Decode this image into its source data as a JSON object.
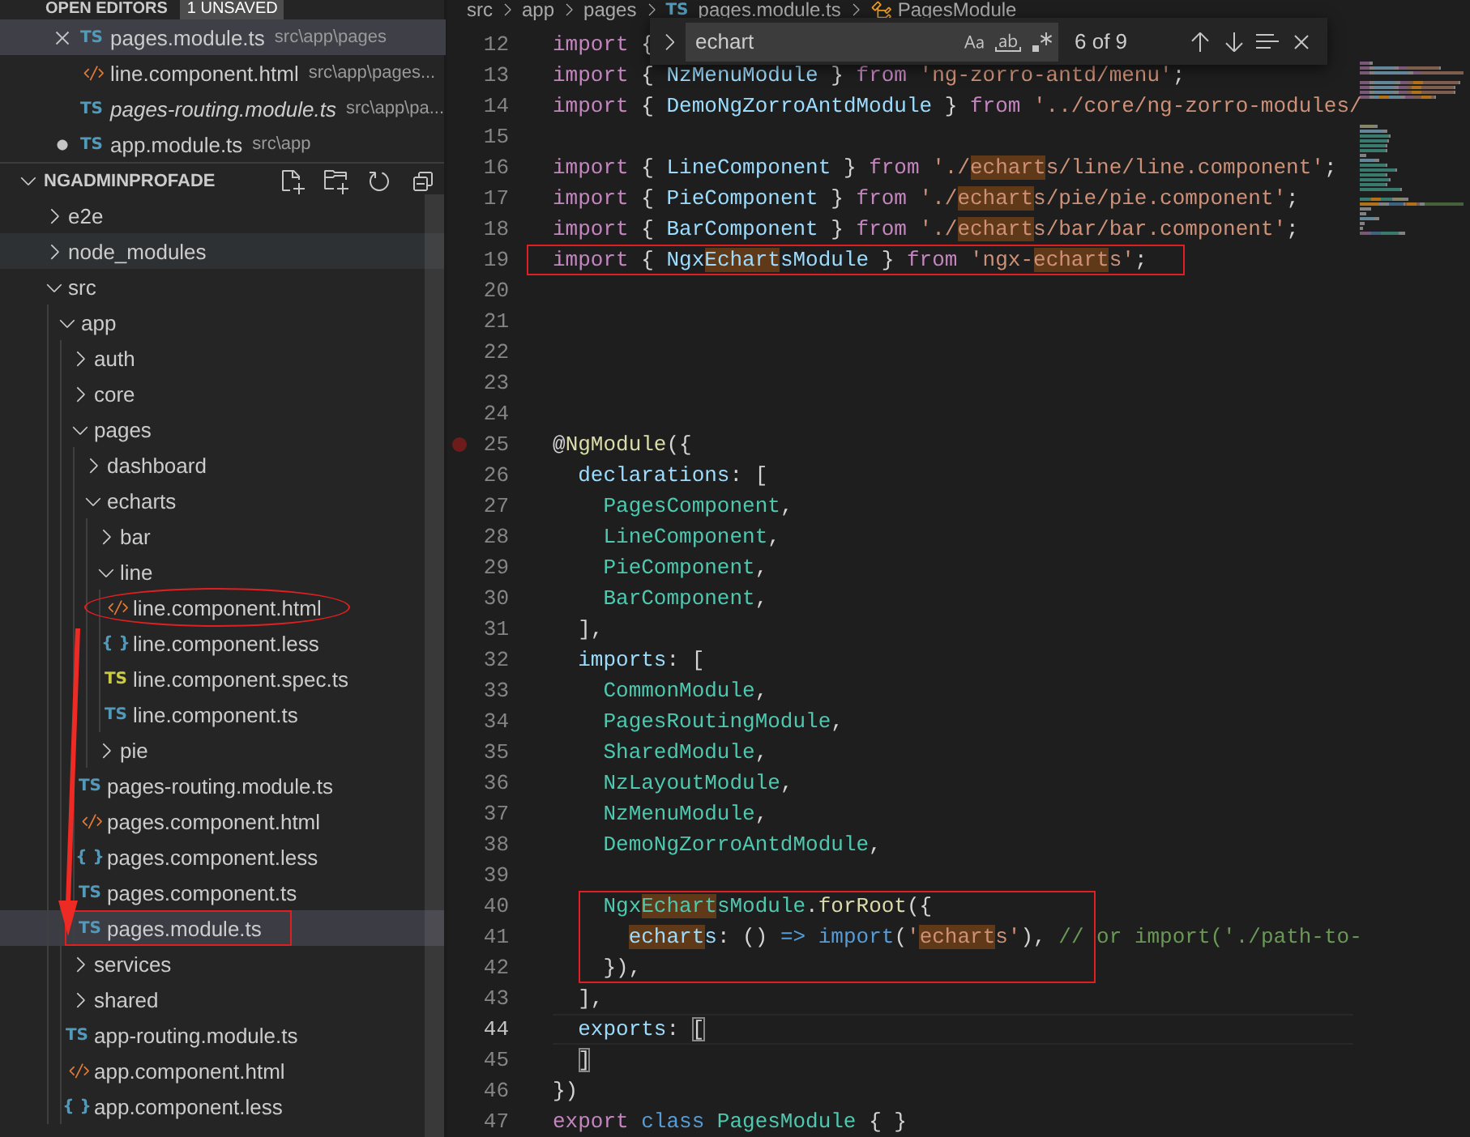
{
  "sidebar": {
    "open_editors": {
      "title": "OPEN EDITORS",
      "badge": "1 UNSAVED",
      "items": [
        {
          "name": "pages.module.ts",
          "path": "src\\app\\pages",
          "kind": "ts",
          "icon": "TS",
          "hovered": true,
          "dirty": false,
          "preview": false,
          "selected": true
        },
        {
          "name": "line.component.html",
          "path": "src\\app\\pages...",
          "kind": "html",
          "hovered": false,
          "dirty": false,
          "preview": false,
          "selected": false
        },
        {
          "name": "pages-routing.module.ts",
          "path": "src\\app\\pa...",
          "kind": "ts",
          "icon": "TS",
          "hovered": false,
          "dirty": false,
          "preview": true,
          "selected": false
        },
        {
          "name": "app.module.ts",
          "path": "src\\app",
          "kind": "ts",
          "icon": "TS",
          "hovered": false,
          "dirty": true,
          "preview": false,
          "selected": false
        }
      ]
    },
    "explorer": {
      "title": "NGADMINPROFADE",
      "expanded": true,
      "actions": [
        {
          "kind": "newfile"
        },
        {
          "kind": "newfolder"
        },
        {
          "kind": "refresh"
        },
        {
          "kind": "collapse"
        }
      ],
      "tree": [
        {
          "name": "e2e",
          "kind": "folder",
          "expanded": false,
          "selected": false,
          "hovered": false
        },
        {
          "name": "node_modules",
          "kind": "folder",
          "expanded": false,
          "selected": false,
          "hovered": true
        },
        {
          "name": "src",
          "kind": "folder",
          "expanded": true,
          "selected": false,
          "hovered": false,
          "children": [
            {
              "name": "app",
              "kind": "folder",
              "expanded": true,
              "selected": false,
              "hovered": false,
              "children": [
                {
                  "name": "auth",
                  "kind": "folder",
                  "expanded": false,
                  "selected": false,
                  "hovered": false
                },
                {
                  "name": "core",
                  "kind": "folder",
                  "expanded": false,
                  "selected": false,
                  "hovered": false
                },
                {
                  "name": "pages",
                  "kind": "folder",
                  "expanded": true,
                  "selected": false,
                  "hovered": false,
                  "children": [
                    {
                      "name": "dashboard",
                      "kind": "folder",
                      "expanded": false,
                      "selected": false,
                      "hovered": false
                    },
                    {
                      "name": "echarts",
                      "kind": "folder",
                      "expanded": true,
                      "selected": false,
                      "hovered": false,
                      "children": [
                        {
                          "name": "bar",
                          "kind": "folder",
                          "expanded": false,
                          "selected": false,
                          "hovered": false
                        },
                        {
                          "name": "line",
                          "kind": "folder",
                          "expanded": true,
                          "selected": false,
                          "hovered": false,
                          "children": [
                            {
                              "name": "line.component.html",
                              "kind": "html",
                              "selected": false,
                              "hovered": false,
                              "annotation": {
                                "kind": "ellipse"
                              }
                            },
                            {
                              "name": "line.component.less",
                              "kind": "less",
                              "icon": "{ }",
                              "selected": false,
                              "hovered": false
                            },
                            {
                              "name": "line.component.spec.ts",
                              "kind": "spec",
                              "icon": "TS",
                              "selected": false,
                              "hovered": false
                            },
                            {
                              "name": "line.component.ts",
                              "kind": "ts",
                              "icon": "TS",
                              "selected": false,
                              "hovered": false
                            }
                          ]
                        },
                        {
                          "name": "pie",
                          "kind": "folder",
                          "expanded": false,
                          "selected": false,
                          "hovered": false
                        }
                      ]
                    },
                    {
                      "name": "pages-routing.module.ts",
                      "kind": "ts",
                      "icon": "TS",
                      "selected": false,
                      "hovered": false
                    },
                    {
                      "name": "pages.component.html",
                      "kind": "html",
                      "selected": false,
                      "hovered": false
                    },
                    {
                      "name": "pages.component.less",
                      "kind": "less",
                      "icon": "{ }",
                      "selected": false,
                      "hovered": false
                    },
                    {
                      "name": "pages.component.ts",
                      "kind": "ts",
                      "icon": "TS",
                      "selected": false,
                      "hovered": false
                    },
                    {
                      "name": "pages.module.ts",
                      "kind": "ts",
                      "icon": "TS",
                      "selected": true,
                      "hovered": false,
                      "annotation": {
                        "kind": "box"
                      }
                    }
                  ]
                },
                {
                  "name": "services",
                  "kind": "folder",
                  "expanded": false,
                  "selected": false,
                  "hovered": false
                },
                {
                  "name": "shared",
                  "kind": "folder",
                  "expanded": false,
                  "selected": false,
                  "hovered": false
                },
                {
                  "name": "app-routing.module.ts",
                  "kind": "ts",
                  "icon": "TS",
                  "selected": false,
                  "hovered": false
                },
                {
                  "name": "app.component.html",
                  "kind": "html",
                  "selected": false,
                  "hovered": false
                },
                {
                  "name": "app.component.less",
                  "kind": "less",
                  "icon": "{ }",
                  "selected": false,
                  "hovered": false
                }
              ]
            }
          ]
        }
      ]
    },
    "annotations": [
      {
        "kind": "arrow"
      }
    ]
  },
  "editor": {
    "breadcrumb": [
      {
        "text": "src",
        "kind": "folder"
      },
      {
        "text": "app",
        "kind": "folder"
      },
      {
        "text": "pages",
        "kind": "folder"
      },
      {
        "text": "pages.module.ts",
        "kind": "file",
        "icon": "TS"
      },
      {
        "text": "PagesModule",
        "kind": "symbol"
      }
    ],
    "find": {
      "value": "echart",
      "replace_expanded": false,
      "options": [
        {
          "kind": "case",
          "on": false
        },
        {
          "kind": "word",
          "on": false
        },
        {
          "kind": "regex",
          "on": false
        }
      ],
      "count": "6 of 9"
    },
    "lines": [
      {
        "kind": "line",
        "number": "12",
        "breakpoint": false,
        "current": false,
        "tokens": [
          {
            "text": "import",
            "kind": "kw",
            "match": false
          },
          {
            "text": " {",
            "kind": "p",
            "match": false
          }
        ]
      },
      {
        "kind": "line",
        "number": "13",
        "breakpoint": false,
        "current": false,
        "tokens": [
          {
            "text": "import",
            "kind": "kw",
            "match": false
          },
          {
            "text": " { ",
            "kind": "p",
            "match": false
          },
          {
            "text": "NzMenuModule",
            "kind": "v",
            "match": false
          },
          {
            "text": " } ",
            "kind": "p",
            "match": false
          },
          {
            "text": "from ",
            "kind": "kw",
            "match": false
          },
          {
            "text": "'ng-zorro-antd/menu'",
            "kind": "s",
            "match": false
          },
          {
            "text": ";",
            "kind": "p",
            "match": false
          }
        ]
      },
      {
        "kind": "line",
        "number": "14",
        "breakpoint": false,
        "current": false,
        "tokens": [
          {
            "text": "import",
            "kind": "kw",
            "match": false
          },
          {
            "text": " { ",
            "kind": "p",
            "match": false
          },
          {
            "text": "DemoNgZorroAntdModule",
            "kind": "v",
            "match": false
          },
          {
            "text": " } ",
            "kind": "p",
            "match": false
          },
          {
            "text": "from ",
            "kind": "kw",
            "match": false
          },
          {
            "text": "'../core/ng-zorro-modules/",
            "kind": "s",
            "match": false
          }
        ]
      },
      {
        "kind": "line",
        "number": "15",
        "breakpoint": false,
        "current": false
      },
      {
        "kind": "line",
        "number": "16",
        "breakpoint": false,
        "current": false,
        "tokens": [
          {
            "text": "import",
            "kind": "kw",
            "match": false
          },
          {
            "text": " { ",
            "kind": "p",
            "match": false
          },
          {
            "text": "LineComponent",
            "kind": "v",
            "match": false
          },
          {
            "text": " } ",
            "kind": "p",
            "match": false
          },
          {
            "text": "from ",
            "kind": "kw",
            "match": false
          },
          {
            "text": "'./",
            "kind": "s",
            "match": false
          },
          {
            "text": "echart",
            "kind": "s",
            "match": true
          },
          {
            "text": "s/line/line.component'",
            "kind": "s",
            "match": false
          },
          {
            "text": ";",
            "kind": "p",
            "match": false
          }
        ]
      },
      {
        "kind": "line",
        "number": "17",
        "breakpoint": false,
        "current": false,
        "tokens": [
          {
            "text": "import",
            "kind": "kw",
            "match": false
          },
          {
            "text": " { ",
            "kind": "p",
            "match": false
          },
          {
            "text": "PieComponent",
            "kind": "v",
            "match": false
          },
          {
            "text": " } ",
            "kind": "p",
            "match": false
          },
          {
            "text": "from ",
            "kind": "kw",
            "match": false
          },
          {
            "text": "'./",
            "kind": "s",
            "match": false
          },
          {
            "text": "echart",
            "kind": "s",
            "match": true
          },
          {
            "text": "s/pie/pie.component'",
            "kind": "s",
            "match": false
          },
          {
            "text": ";",
            "kind": "p",
            "match": false
          }
        ]
      },
      {
        "kind": "line",
        "number": "18",
        "breakpoint": false,
        "current": false,
        "tokens": [
          {
            "text": "import",
            "kind": "kw",
            "match": false
          },
          {
            "text": " { ",
            "kind": "p",
            "match": false
          },
          {
            "text": "BarComponent",
            "kind": "v",
            "match": false
          },
          {
            "text": " } ",
            "kind": "p",
            "match": false
          },
          {
            "text": "from ",
            "kind": "kw",
            "match": false
          },
          {
            "text": "'./",
            "kind": "s",
            "match": false
          },
          {
            "text": "echart",
            "kind": "s",
            "match": true
          },
          {
            "text": "s/bar/bar.component'",
            "kind": "s",
            "match": false
          },
          {
            "text": ";",
            "kind": "p",
            "match": false
          }
        ]
      },
      {
        "kind": "box",
        "lines": [
          {
            "kind": "line",
            "number": "19",
            "breakpoint": false,
            "current": false,
            "tokens": [
              {
                "text": "import",
                "kind": "kw",
                "match": false
              },
              {
                "text": " { ",
                "kind": "p",
                "match": false
              },
              {
                "text": "Ngx",
                "kind": "v",
                "match": false
              },
              {
                "text": "Echart",
                "kind": "v",
                "match": true
              },
              {
                "text": "sModule",
                "kind": "v",
                "match": false
              },
              {
                "text": " } ",
                "kind": "p",
                "match": false
              },
              {
                "text": "from ",
                "kind": "kw",
                "match": false
              },
              {
                "text": "'ngx-",
                "kind": "s",
                "match": false
              },
              {
                "text": "echart",
                "kind": "s",
                "match": true
              },
              {
                "text": "s'",
                "kind": "s",
                "match": false
              },
              {
                "text": ";",
                "kind": "p",
                "match": false
              }
            ]
          }
        ]
      },
      {
        "kind": "line",
        "number": "20",
        "breakpoint": false,
        "current": false
      },
      {
        "kind": "line",
        "number": "21",
        "breakpoint": false,
        "current": false
      },
      {
        "kind": "line",
        "number": "22",
        "breakpoint": false,
        "current": false
      },
      {
        "kind": "line",
        "number": "23",
        "breakpoint": false,
        "current": false
      },
      {
        "kind": "line",
        "number": "24",
        "breakpoint": false,
        "current": false
      },
      {
        "kind": "line",
        "number": "25",
        "breakpoint": true,
        "current": false,
        "tokens": [
          {
            "text": "@",
            "kind": "p",
            "match": false
          },
          {
            "text": "NgModule",
            "kind": "f",
            "match": false
          },
          {
            "text": "({",
            "kind": "p",
            "match": false
          }
        ]
      },
      {
        "kind": "line",
        "number": "26",
        "breakpoint": false,
        "current": false,
        "tokens": [
          {
            "text": "  declarations",
            "kind": "v",
            "match": false
          },
          {
            "text": ": [",
            "kind": "p",
            "match": false
          }
        ]
      },
      {
        "kind": "line",
        "number": "27",
        "breakpoint": false,
        "current": false,
        "tokens": [
          {
            "text": "    PagesComponent",
            "kind": "t",
            "match": false
          },
          {
            "text": ",",
            "kind": "p",
            "match": false
          }
        ]
      },
      {
        "kind": "line",
        "number": "28",
        "breakpoint": false,
        "current": false,
        "tokens": [
          {
            "text": "    LineComponent",
            "kind": "t",
            "match": false
          },
          {
            "text": ",",
            "kind": "p",
            "match": false
          }
        ]
      },
      {
        "kind": "line",
        "number": "29",
        "breakpoint": false,
        "current": false,
        "tokens": [
          {
            "text": "    PieComponent",
            "kind": "t",
            "match": false
          },
          {
            "text": ",",
            "kind": "p",
            "match": false
          }
        ]
      },
      {
        "kind": "line",
        "number": "30",
        "breakpoint": false,
        "current": false,
        "tokens": [
          {
            "text": "    BarComponent",
            "kind": "t",
            "match": false
          },
          {
            "text": ",",
            "kind": "p",
            "match": false
          }
        ]
      },
      {
        "kind": "line",
        "number": "31",
        "breakpoint": false,
        "current": false,
        "tokens": [
          {
            "text": "  ],",
            "kind": "p",
            "match": false
          }
        ]
      },
      {
        "kind": "line",
        "number": "32",
        "breakpoint": false,
        "current": false,
        "tokens": [
          {
            "text": "  imports",
            "kind": "v",
            "match": false
          },
          {
            "text": ": [",
            "kind": "p",
            "match": false
          }
        ]
      },
      {
        "kind": "line",
        "number": "33",
        "breakpoint": false,
        "current": false,
        "tokens": [
          {
            "text": "    CommonModule",
            "kind": "t",
            "match": false
          },
          {
            "text": ",",
            "kind": "p",
            "match": false
          }
        ]
      },
      {
        "kind": "line",
        "number": "34",
        "breakpoint": false,
        "current": false,
        "tokens": [
          {
            "text": "    PagesRoutingModule",
            "kind": "t",
            "match": false
          },
          {
            "text": ",",
            "kind": "p",
            "match": false
          }
        ]
      },
      {
        "kind": "line",
        "number": "35",
        "breakpoint": false,
        "current": false,
        "tokens": [
          {
            "text": "    SharedModule",
            "kind": "t",
            "match": false
          },
          {
            "text": ",",
            "kind": "p",
            "match": false
          }
        ]
      },
      {
        "kind": "line",
        "number": "36",
        "breakpoint": false,
        "current": false,
        "tokens": [
          {
            "text": "    NzLayoutModule",
            "kind": "t",
            "match": false
          },
          {
            "text": ",",
            "kind": "p",
            "match": false
          }
        ]
      },
      {
        "kind": "line",
        "number": "37",
        "breakpoint": false,
        "current": false,
        "tokens": [
          {
            "text": "    NzMenuModule",
            "kind": "t",
            "match": false
          },
          {
            "text": ",",
            "kind": "p",
            "match": false
          }
        ]
      },
      {
        "kind": "line",
        "number": "38",
        "breakpoint": false,
        "current": false,
        "tokens": [
          {
            "text": "    DemoNgZorroAntdModule",
            "kind": "t",
            "match": false
          },
          {
            "text": ",",
            "kind": "p",
            "match": false
          }
        ]
      },
      {
        "kind": "line",
        "number": "39",
        "breakpoint": false,
        "current": false
      },
      {
        "kind": "box",
        "lines": [
          {
            "kind": "line",
            "number": "40",
            "breakpoint": false,
            "current": false,
            "tokens": [
              {
                "text": "    Ngx",
                "kind": "t",
                "match": false
              },
              {
                "text": "Echart",
                "kind": "t",
                "match": true
              },
              {
                "text": "sModule",
                "kind": "t",
                "match": false
              },
              {
                "text": ".",
                "kind": "p",
                "match": false
              },
              {
                "text": "forRoot",
                "kind": "f",
                "match": false
              },
              {
                "text": "({",
                "kind": "p",
                "match": false
              }
            ]
          },
          {
            "kind": "line",
            "number": "41",
            "breakpoint": false,
            "current": false,
            "tokens": [
              {
                "text": "      echart",
                "kind": "v",
                "match": true
              },
              {
                "text": "s",
                "kind": "v",
                "match": false
              },
              {
                "text": ": () ",
                "kind": "p",
                "match": false
              },
              {
                "text": "=>",
                "kind": "k2",
                "match": false
              },
              {
                "text": " import",
                "kind": "k2",
                "match": false
              },
              {
                "text": "(",
                "kind": "p",
                "match": false
              },
              {
                "text": "'",
                "kind": "s",
                "match": false
              },
              {
                "text": "echart",
                "kind": "s",
                "match": true
              },
              {
                "text": "s'",
                "kind": "s",
                "match": false
              },
              {
                "text": "), ",
                "kind": "p",
                "match": false
              },
              {
                "text": "// or import('./path-to-",
                "kind": "c",
                "match": false
              }
            ]
          },
          {
            "kind": "line",
            "number": "42",
            "breakpoint": false,
            "current": false,
            "tokens": [
              {
                "text": "    }),",
                "kind": "p",
                "match": false
              }
            ]
          }
        ]
      },
      {
        "kind": "line",
        "number": "43",
        "breakpoint": false,
        "current": false,
        "tokens": [
          {
            "text": "  ],",
            "kind": "p",
            "match": false
          }
        ]
      },
      {
        "kind": "line",
        "number": "44",
        "breakpoint": false,
        "current": true,
        "tokens": [
          {
            "text": "  exports",
            "kind": "v",
            "match": false
          },
          {
            "text": ": ",
            "kind": "p",
            "match": false
          },
          {
            "text": "[",
            "kind": "br",
            "match": false
          }
        ]
      },
      {
        "kind": "line",
        "number": "45",
        "breakpoint": false,
        "current": false,
        "tokens": [
          {
            "text": "  ]",
            "kind": "br",
            "match": false
          }
        ]
      },
      {
        "kind": "line",
        "number": "46",
        "breakpoint": false,
        "current": false,
        "tokens": [
          {
            "text": "})",
            "kind": "p",
            "match": false
          }
        ]
      },
      {
        "kind": "line",
        "number": "47",
        "breakpoint": false,
        "current": false,
        "tokens": [
          {
            "text": "export ",
            "kind": "kw",
            "match": false
          },
          {
            "text": "class ",
            "kind": "k2",
            "match": false
          },
          {
            "text": "PagesModule",
            "kind": "t",
            "match": false
          },
          {
            "text": " { }",
            "kind": "p",
            "match": false
          }
        ]
      }
    ]
  }
}
